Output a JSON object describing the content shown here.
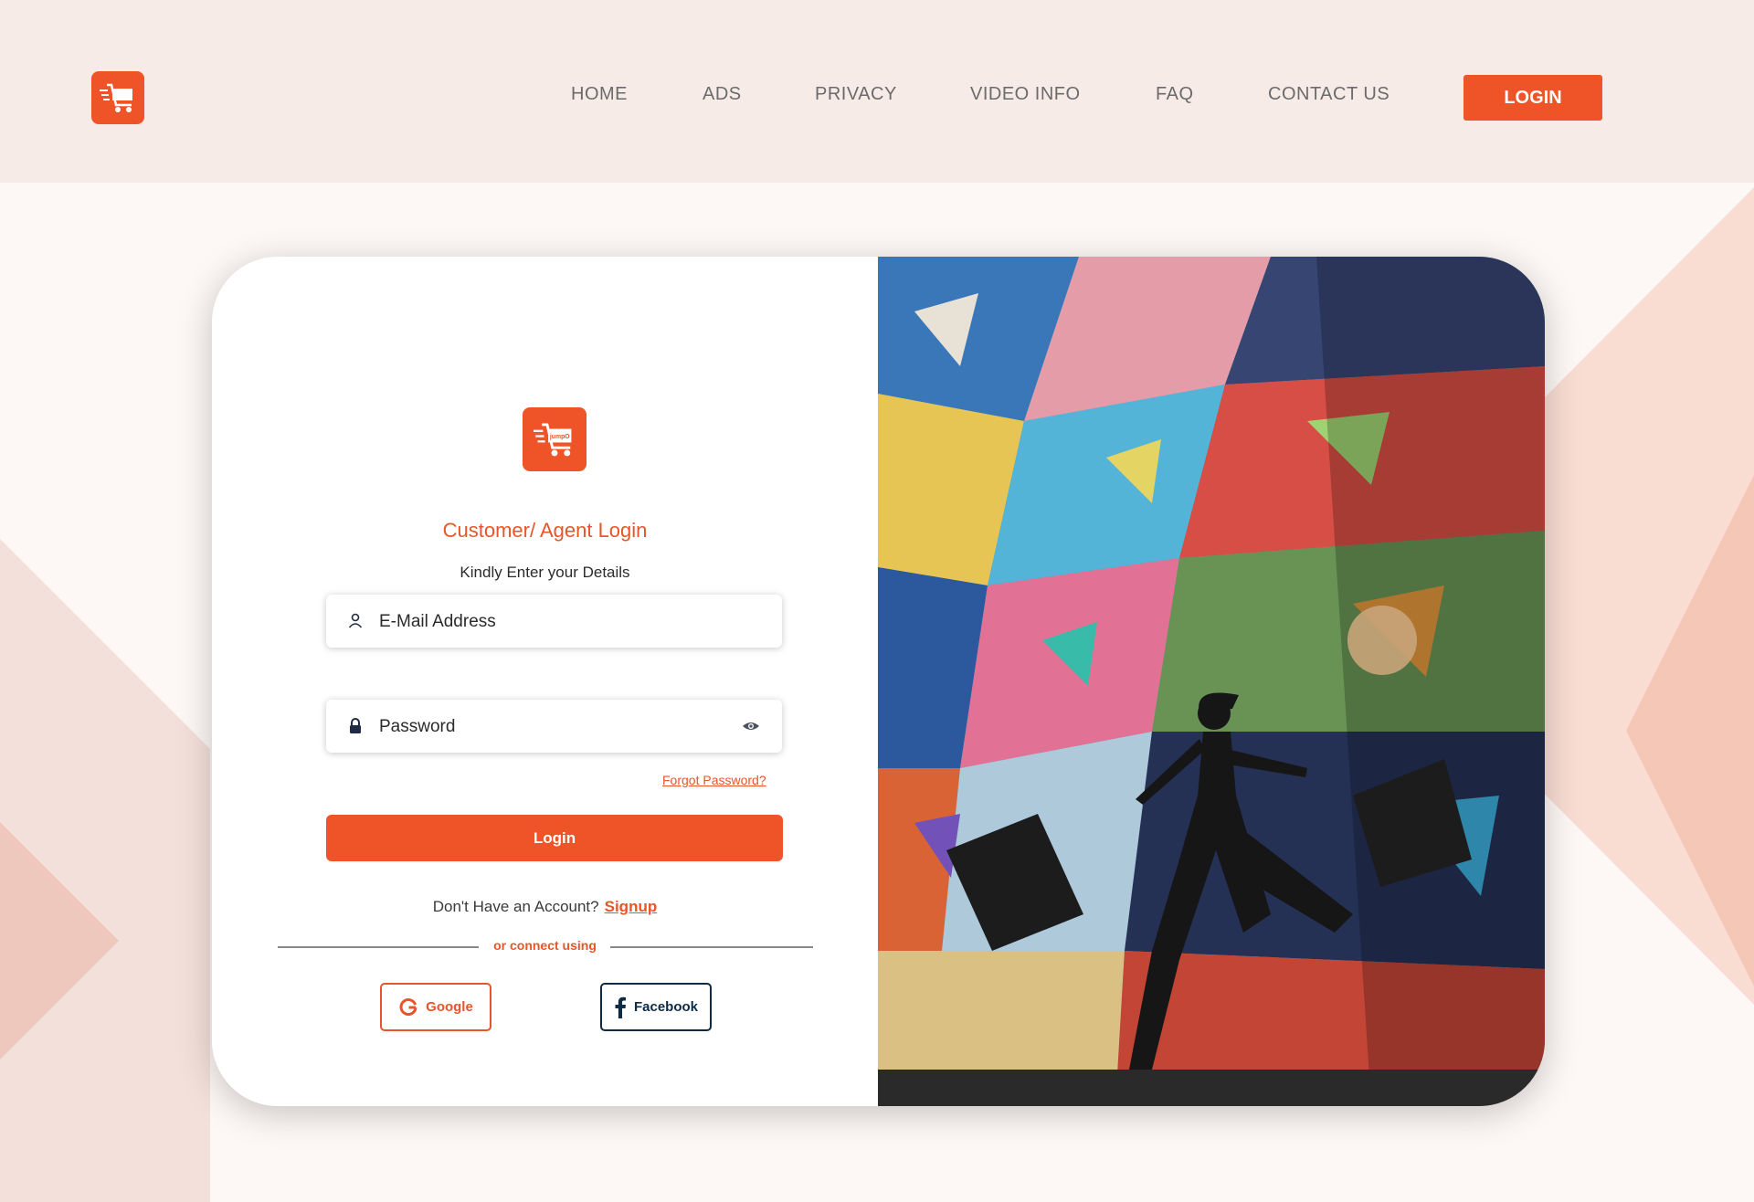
{
  "brand": {
    "accent": "#ef5428",
    "logo_text": "jumpO"
  },
  "nav": {
    "items": [
      {
        "label": "HOME"
      },
      {
        "label": "ADS"
      },
      {
        "label": "PRIVACY"
      },
      {
        "label": "VIDEO INFO"
      },
      {
        "label": "FAQ"
      },
      {
        "label": "CONTACT US"
      }
    ],
    "login_label": "LOGIN"
  },
  "login": {
    "title": "Customer/ Agent Login",
    "subtitle": "Kindly Enter your Details",
    "email_placeholder": "E-Mail Address",
    "password_placeholder": "Password",
    "forgot_label": "Forgot Password?",
    "submit_label": "Login",
    "no_account_text": "Don't Have an Account?",
    "signup_label": "Signup",
    "connect_text": "or connect using",
    "google_label": "Google",
    "facebook_label": "Facebook"
  },
  "icons": {
    "logo": "shopping-cart-icon",
    "email": "user-icon",
    "password": "lock-icon",
    "toggle": "eye-icon",
    "google": "google-icon",
    "facebook": "facebook-icon"
  }
}
